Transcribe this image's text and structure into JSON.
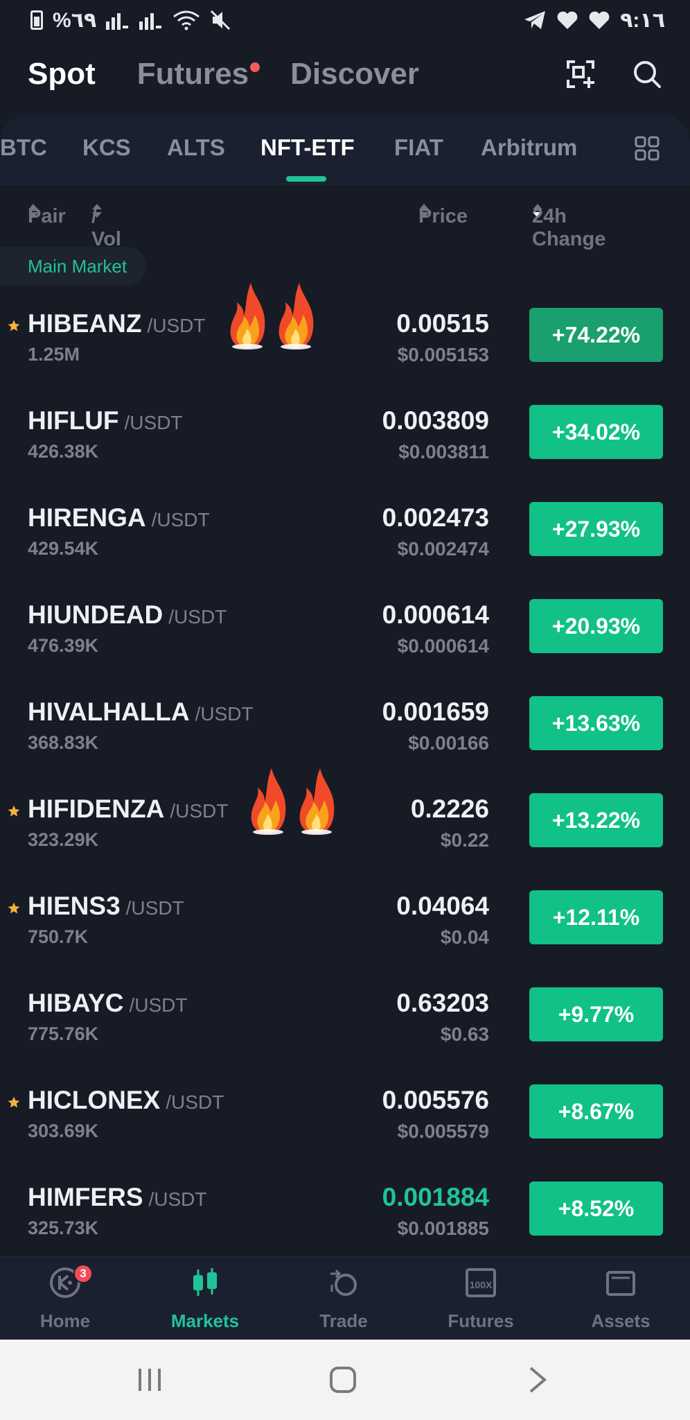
{
  "status_bar": {
    "left": "%٦٩",
    "time": "٩:١٦"
  },
  "top_nav": {
    "tabs": [
      "Spot",
      "Futures",
      "Discover"
    ]
  },
  "sub_tabs": [
    "BTC",
    "KCS",
    "ALTS",
    "NFT-ETF",
    "FIAT",
    "Arbitrum"
  ],
  "column_headers": {
    "pair": "Pair",
    "vol": "/ Vol",
    "price": "Price",
    "change": "24h Change"
  },
  "market_pill": "Main Market",
  "rows": [
    {
      "symbol": "HIBEANZ",
      "quote": "/USDT",
      "vol": "1.25M",
      "price": "0.00515",
      "fiat": "$0.005153",
      "change": "+74.22%",
      "starred": true,
      "fire": true
    },
    {
      "symbol": "HIFLUF",
      "quote": "/USDT",
      "vol": "426.38K",
      "price": "0.003809",
      "fiat": "$0.003811",
      "change": "+34.02%",
      "starred": false,
      "fire": false
    },
    {
      "symbol": "HIRENGA",
      "quote": "/USDT",
      "vol": "429.54K",
      "price": "0.002473",
      "fiat": "$0.002474",
      "change": "+27.93%",
      "starred": false,
      "fire": false
    },
    {
      "symbol": "HIUNDEAD",
      "quote": "/USDT",
      "vol": "476.39K",
      "price": "0.000614",
      "fiat": "$0.000614",
      "change": "+20.93%",
      "starred": false,
      "fire": false
    },
    {
      "symbol": "HIVALHALLA",
      "quote": "/USDT",
      "vol": "368.83K",
      "price": "0.001659",
      "fiat": "$0.00166",
      "change": "+13.63%",
      "starred": false,
      "fire": false
    },
    {
      "symbol": "HIFIDENZA",
      "quote": "/USDT",
      "vol": "323.29K",
      "price": "0.2226",
      "fiat": "$0.22",
      "change": "+13.22%",
      "starred": true,
      "fire": true
    },
    {
      "symbol": "HIENS3",
      "quote": "/USDT",
      "vol": "750.7K",
      "price": "0.04064",
      "fiat": "$0.04",
      "change": "+12.11%",
      "starred": true,
      "fire": false
    },
    {
      "symbol": "HIBAYC",
      "quote": "/USDT",
      "vol": "775.76K",
      "price": "0.63203",
      "fiat": "$0.63",
      "change": "+9.77%",
      "starred": false,
      "fire": false
    },
    {
      "symbol": "HICLONEX",
      "quote": "/USDT",
      "vol": "303.69K",
      "price": "0.005576",
      "fiat": "$0.005579",
      "change": "+8.67%",
      "starred": true,
      "fire": false
    },
    {
      "symbol": "HIMFERS",
      "quote": "/USDT",
      "vol": "325.73K",
      "price": "0.001884",
      "fiat": "$0.001885",
      "change": "+8.52%",
      "starred": false,
      "fire": false,
      "price_color": "#21c397"
    }
  ],
  "bottom_nav": {
    "items": [
      "Home",
      "Markets",
      "Trade",
      "Futures",
      "Assets"
    ],
    "home_badge": "3"
  },
  "colors": {
    "accent": "#21c397",
    "positive": "#11c187",
    "background": "#171b25"
  }
}
